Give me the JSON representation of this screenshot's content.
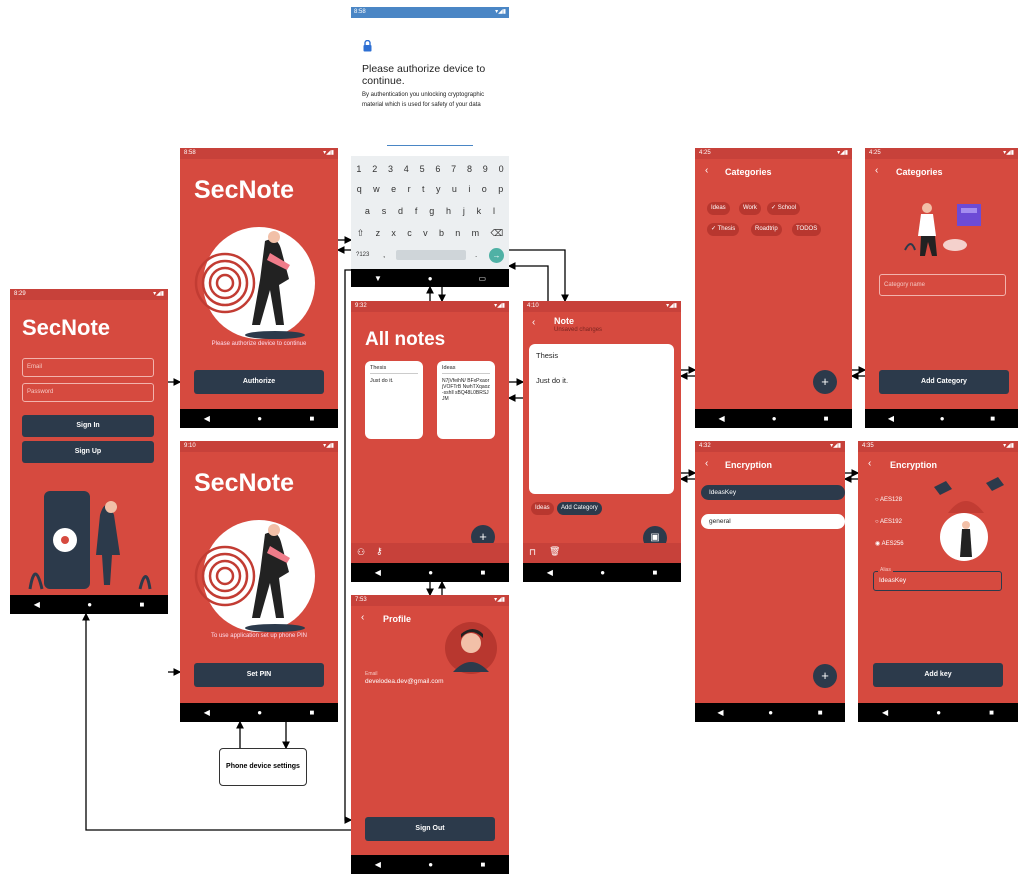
{
  "auth_prompt": {
    "time": "8:58",
    "title": "Please authorize device to continue.",
    "body": "By authentication you unlocking cryptographic material which is used for safety of your data"
  },
  "signin": {
    "time": "8:29",
    "app_name": "SecNote",
    "email_placeholder": "Email",
    "password_placeholder": "Password",
    "signin_label": "Sign In",
    "signup_label": "Sign Up"
  },
  "authorize": {
    "time": "8:58",
    "app_name": "SecNote",
    "message": "Please authorize device to continue",
    "button_label": "Authorize"
  },
  "setpin": {
    "time": "9:10",
    "app_name": "SecNote",
    "message": "To use application set up phone PIN",
    "button_label": "Set PIN"
  },
  "phone_settings": {
    "label": "Phone device settings"
  },
  "keyboard": {
    "row1": [
      "1",
      "2",
      "3",
      "4",
      "5",
      "6",
      "7",
      "8",
      "9",
      "0"
    ],
    "row2": [
      "q",
      "w",
      "e",
      "r",
      "t",
      "y",
      "u",
      "i",
      "o",
      "p"
    ],
    "row3": [
      "a",
      "s",
      "d",
      "f",
      "g",
      "h",
      "j",
      "k",
      "l"
    ],
    "row4": [
      "⇧",
      "z",
      "x",
      "c",
      "v",
      "b",
      "n",
      "m",
      "⌫"
    ],
    "sym": "?123",
    "comma": ",",
    "period": "."
  },
  "allnotes": {
    "time": "9:32",
    "title": "All notes",
    "notes": [
      {
        "title": "Thesis",
        "body": "Just do it."
      },
      {
        "title": "Ideas",
        "body": "N7jVfeihN/ BFxPxaorjVOFTrB NwhTXqaoz-sshll sBQ48L0BRSJJM"
      }
    ]
  },
  "note": {
    "time": "4:10",
    "title": "Note",
    "subtitle": "Unsaved changes",
    "heading": "Thesis",
    "body": "Just do it.",
    "chip": "Ideas",
    "add_category": "Add Category"
  },
  "profile": {
    "time": "7:53",
    "title": "Profile",
    "email_label": "Email",
    "email": "develodea.dev@gmail.com",
    "signout_label": "Sign Out"
  },
  "categories": {
    "time": "4:25",
    "title": "Categories",
    "chips": [
      "Ideas",
      "Work",
      "School",
      "Thesis",
      "Roadtrip",
      "TODOS"
    ]
  },
  "categories_add": {
    "time": "4:25",
    "title": "Categories",
    "placeholder": "Category name",
    "button_label": "Add Category"
  },
  "encryption": {
    "time": "4:32",
    "title": "Encryption",
    "items": [
      "IdeasKey",
      "general"
    ]
  },
  "encryption_add": {
    "time": "4:35",
    "title": "Encryption",
    "options": [
      "AES128",
      "AES192",
      "AES256"
    ],
    "alias_label": "Alias",
    "alias_value": "IdeasKey",
    "button_label": "Add key"
  },
  "colors": {
    "primary": "#d64a3f",
    "dark": "#2c3a4b",
    "status": "#c7413a"
  }
}
